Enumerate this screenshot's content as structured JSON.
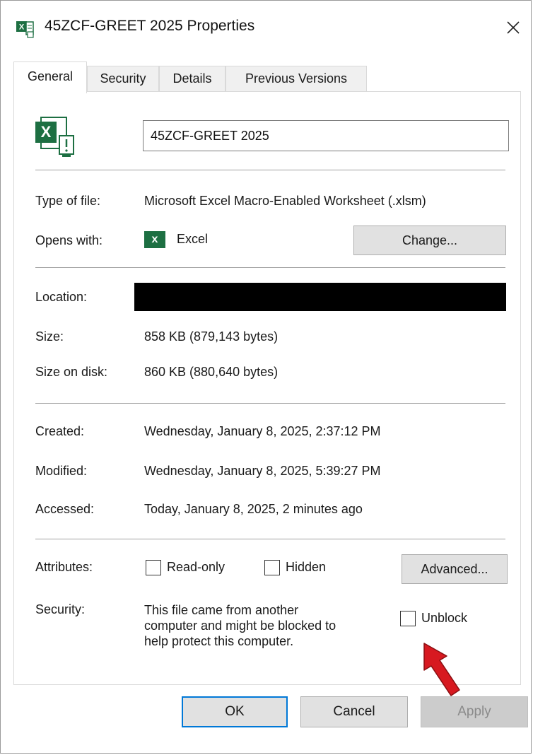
{
  "window": {
    "title": "45ZCF-GREET 2025 Properties",
    "close_glyph": "✕"
  },
  "tabs": [
    {
      "label": "General",
      "active": true
    },
    {
      "label": "Security",
      "active": false
    },
    {
      "label": "Details",
      "active": false
    },
    {
      "label": "Previous Versions",
      "active": false
    }
  ],
  "general": {
    "file_name_value": "45ZCF-GREET 2025",
    "type_label": "Type of file:",
    "type_value": "Microsoft Excel Macro-Enabled Worksheet (.xlsm)",
    "opens_label": "Opens with:",
    "opens_app": "Excel",
    "app_icon_letter": "x",
    "change_button": "Change...",
    "location_label": "Location:",
    "size_label": "Size:",
    "size_value": "858 KB (879,143 bytes)",
    "size_disk_label": "Size on disk:",
    "size_disk_value": "860 KB (880,640 bytes)",
    "created_label": "Created:",
    "created_value": "Wednesday, January 8, 2025, 2:37:12 PM",
    "modified_label": "Modified:",
    "modified_value": "Wednesday, January 8, 2025, 5:39:27 PM",
    "accessed_label": "Accessed:",
    "accessed_value": "Today, January 8, 2025, 2 minutes ago",
    "attributes_label": "Attributes:",
    "readonly_label": "Read-only",
    "readonly_checked": false,
    "hidden_label": "Hidden",
    "hidden_checked": false,
    "advanced_button": "Advanced...",
    "security_label": "Security:",
    "security_lines": [
      "This file came from another",
      "computer and might be blocked to",
      "help protect this computer."
    ],
    "unblock_label": "Unblock",
    "unblock_checked": false
  },
  "footer": {
    "ok": "OK",
    "cancel": "Cancel",
    "apply": "Apply"
  },
  "colors": {
    "excel_green": "#1d6f42",
    "arrow_red": "#d71920",
    "focus_blue": "#0078d7",
    "redaction": "#000000"
  },
  "icons": {
    "title": "excel-file-icon",
    "big_file": "excel-blocked-file-icon",
    "opens_with": "excel-app-icon",
    "close": "close-icon",
    "annotation": "red-arrow-icon"
  }
}
